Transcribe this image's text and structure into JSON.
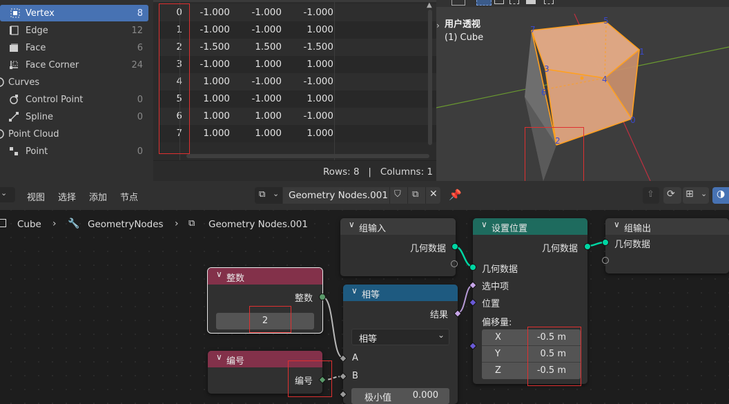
{
  "spreadsheet": {
    "tree": [
      {
        "label": "Vertex",
        "count": "8",
        "icon": "vertex-icon",
        "active": true
      },
      {
        "label": "Edge",
        "count": "12",
        "icon": "edge-icon"
      },
      {
        "label": "Face",
        "count": "6",
        "icon": "face-icon"
      },
      {
        "label": "Face Corner",
        "count": "24",
        "icon": "face-corner-icon"
      },
      {
        "label": "Curves",
        "count": "",
        "icon": "curves-icon"
      },
      {
        "label": "Control Point",
        "count": "0",
        "icon": "control-point-icon"
      },
      {
        "label": "Spline",
        "count": "0",
        "icon": "spline-icon"
      },
      {
        "label": "Point Cloud",
        "count": "",
        "icon": "point-cloud-icon"
      },
      {
        "label": "Point",
        "count": "0",
        "icon": "point-icon"
      }
    ],
    "rows": [
      {
        "idx": "0",
        "x": "-1.000",
        "y": "-1.000",
        "z": "-1.000"
      },
      {
        "idx": "1",
        "x": "-1.000",
        "y": "-1.000",
        "z": "1.000"
      },
      {
        "idx": "2",
        "x": "-1.500",
        "y": "1.500",
        "z": "-1.500"
      },
      {
        "idx": "3",
        "x": "-1.000",
        "y": "1.000",
        "z": "1.000"
      },
      {
        "idx": "4",
        "x": "1.000",
        "y": "-1.000",
        "z": "-1.000"
      },
      {
        "idx": "5",
        "x": "1.000",
        "y": "-1.000",
        "z": "1.000"
      },
      {
        "idx": "6",
        "x": "1.000",
        "y": "1.000",
        "z": "-1.000"
      },
      {
        "idx": "7",
        "x": "1.000",
        "y": "1.000",
        "z": "1.000"
      }
    ],
    "footer": "Rows: 8   |   Columns: 1"
  },
  "viewport": {
    "view_name": "用户透视",
    "object_name": "(1) Cube",
    "vertex_labels": [
      "0",
      "1",
      "2",
      "3",
      "4",
      "5",
      "6",
      "7"
    ],
    "colors": {
      "bg": "#3d3d3d",
      "cube_face": "#d9a07a",
      "cube_edge": "#ffa020",
      "x_axis": "#c03040",
      "y_axis": "#6a9a30",
      "vertex_label": "#3a48c8"
    }
  },
  "node_editor": {
    "menu": [
      "视图",
      "选择",
      "添加",
      "节点"
    ],
    "tree_name": "Geometry Nodes.001",
    "breadcrumb": [
      "Cube",
      "GeometryNodes",
      "Geometry Nodes.001"
    ]
  },
  "nodes": {
    "group_input": {
      "title": "组输入",
      "out_geometry": "几何数据"
    },
    "set_position": {
      "title": "设置位置",
      "out_geometry": "几何数据",
      "in_geometry": "几何数据",
      "in_selection": "选中项",
      "in_position": "位置",
      "offset_label": "偏移量:",
      "offset": [
        {
          "axis": "X",
          "value": "-0.5 m"
        },
        {
          "axis": "Y",
          "value": "0.5 m"
        },
        {
          "axis": "Z",
          "value": "-0.5 m"
        }
      ]
    },
    "group_output": {
      "title": "组输出",
      "in_geometry": "几何数据"
    },
    "integer": {
      "title": "整数",
      "out_label": "整数",
      "value": "2"
    },
    "compare": {
      "title": "相等",
      "out_result": "结果",
      "mode": "相等",
      "in_a": "A",
      "in_b": "B",
      "epsilon_label": "极小值",
      "epsilon_value": "0.000"
    },
    "index": {
      "title": "编号",
      "out_label": "编号"
    }
  },
  "colors": {
    "accent": "#4772b3",
    "geometry_socket": "#00d6a3",
    "input_header": "#83314a",
    "set_position_header": "#1e6b5e",
    "compare_header": "#1e5a80",
    "annotation": "#e03030"
  }
}
